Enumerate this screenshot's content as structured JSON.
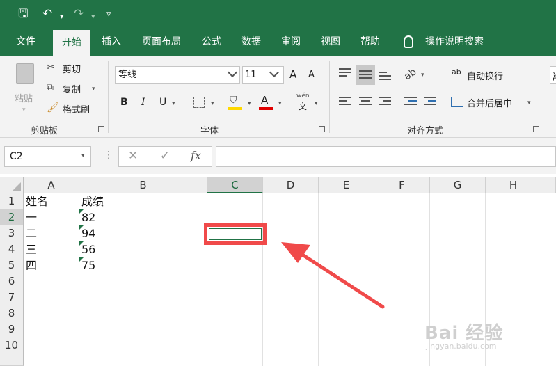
{
  "quick_access": {
    "save": "🖫",
    "undo": "↶",
    "redo": "↷",
    "customize": "▿",
    "dropdown": "▾"
  },
  "tabs": [
    "文件",
    "开始",
    "插入",
    "页面布局",
    "公式",
    "数据",
    "审阅",
    "视图",
    "帮助"
  ],
  "active_tab": "开始",
  "tell_me": "操作说明搜索",
  "ribbon": {
    "clipboard": {
      "paste": "粘贴",
      "cut": "剪切",
      "copy": "复制",
      "format_painter": "格式刷",
      "label": "剪贴板"
    },
    "font": {
      "name": "等线",
      "size": "11",
      "grow": "A",
      "shrink": "A",
      "bold": "B",
      "italic": "I",
      "underline": "U",
      "pinyin_top": "wén",
      "pinyin_char": "文",
      "color_letter": "A",
      "label": "字体"
    },
    "alignment": {
      "wrap_text": "自动换行",
      "wrap_icon": "ab",
      "merge_center": "合并后居中",
      "label": "对齐方式"
    },
    "next_group_partial": "常"
  },
  "formula_bar": {
    "name_box": "C2",
    "cancel": "✕",
    "enter": "✓",
    "fx": "fx",
    "value": ""
  },
  "columns": [
    "A",
    "B",
    "C",
    "D",
    "E",
    "F",
    "G",
    "H"
  ],
  "rows": [
    "1",
    "2",
    "3",
    "4",
    "5",
    "6",
    "7",
    "8",
    "9",
    "10"
  ],
  "cells": {
    "A1": "姓名",
    "B1": "成绩",
    "A2": "一",
    "B2": "82",
    "A3": "二",
    "B3": "94",
    "A4": "三",
    "B4": "56",
    "A5": "四",
    "B5": "75"
  },
  "watermark": {
    "brand": "Bai 经验",
    "url": "jingyan.baidu.com"
  },
  "colors": {
    "accent": "#217346",
    "highlight": "#f04a4a",
    "fill_color": "#ffd800",
    "font_color": "#e00000"
  }
}
